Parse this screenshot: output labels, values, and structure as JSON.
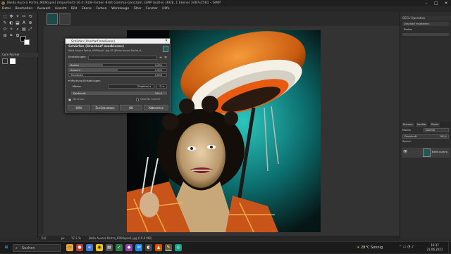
{
  "window": {
    "title": "[Bella Aurora Portra_900Kopie] (importiert)-16.0 (RGB-Farben 8-Bit Gamma-Ganzzahl, GIMP built-in sRGB, 1 Ebene) 3487x2561 – GIMP",
    "min": "–",
    "max": "□",
    "close": "✕"
  },
  "menu": [
    "Datei",
    "Bearbeiten",
    "Auswahl",
    "Ansicht",
    "Bild",
    "Ebene",
    "Farben",
    "Werkzeuge",
    "Filter",
    "Fenster",
    "Hilfe"
  ],
  "toolbox": {
    "tools": [
      "⬚",
      "✥",
      "⌖",
      "✂",
      "⟲",
      "✎",
      "◐",
      "⬓",
      "A",
      "⊕",
      "⬭",
      "✧",
      "⌕",
      "▤",
      "⤢",
      "◍",
      "✒",
      "⧉"
    ],
    "panel_title": "Core Pointer"
  },
  "dialog": {
    "window_title": "Schärfen (Unscharf maskieren)",
    "heading": "Schärfen (Unscharf maskieren)",
    "subheading": "Bella Aurora Portra_900Kopie1.jpg-28 ([Bella Aurora Portra_9...",
    "settings_label": "Einstellungen:",
    "sliders": [
      {
        "label": "Radius",
        "value": "3,000",
        "fraction": 0.35
      },
      {
        "label": "Amount",
        "value": "0,500",
        "fraction": 0.5
      },
      {
        "label": "Threshold",
        "value": "0,000",
        "fraction": 0.0
      }
    ],
    "blend_section": "Mischung Einstellungen",
    "mode_label": "Modus",
    "mode_value": "Ersetzen",
    "opacity_label": "Deckkraft",
    "opacity_value": "100,0",
    "preview_label": "Vorschau",
    "split_label": "Geteilte Ansicht",
    "buttons": [
      "Hilfe",
      "Zurücksetzen",
      "OK",
      "Abbrechen"
    ]
  },
  "status": {
    "unit": "px",
    "zoom": "17,1 %",
    "info": "Bella Aurora Portra_900Kopie1.jpg (19,9 MB)"
  },
  "right_dock": {
    "history_title": "GEGL-Operation",
    "history_item": "Unscharf maskieren",
    "radius_label": "Radius",
    "layers_tabs": [
      "Ebenen",
      "Kanäle",
      "Pfade"
    ],
    "mode_label": "Modus",
    "mode_value": "Normal",
    "opacity_label": "Deckkraft",
    "opacity_value": "100,0",
    "lock_label": "Sperre:",
    "layer_name": "Bella Aurora"
  },
  "taskbar": {
    "search": "Suchen",
    "weather": "28°C  Sonnig",
    "time": "16:37",
    "date": "21.06.2021"
  },
  "colors": {
    "accent": "#e07b1a",
    "teal": "#1fa7a0"
  }
}
